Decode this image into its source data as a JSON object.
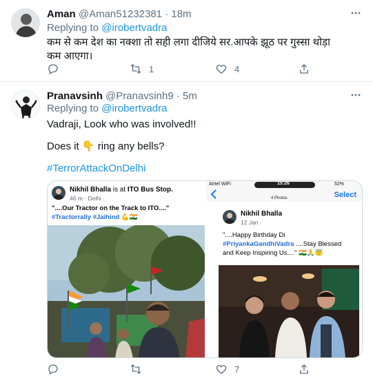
{
  "tweet1": {
    "name": "Aman",
    "handle": "@Aman51232381",
    "separator": "·",
    "time": "18m",
    "replying_prefix": "Replying to",
    "replying_handle": "@irobertvadra",
    "text": "कम से कम देश का नक्शा तो सही लगा दीजिये सर.आपके झूठ पर गुस्सा थोड़ा कम आएगा।",
    "retweet_count": "1",
    "like_count": "4"
  },
  "tweet2": {
    "name": "Pranavsinh",
    "handle": "@Pranavsinh9",
    "separator": "·",
    "time": "5m",
    "replying_prefix": "Replying to",
    "replying_handle": "@irobertvadra",
    "line1": "Vadraji, Look who was involved!!",
    "line2_pre": "Does it",
    "line2_emoji": "👇",
    "line2_post": "ring any bells?",
    "hashtag": "#TerrorAttackOnDelhi",
    "retweet_count": "",
    "like_count": "7"
  },
  "photo_left": {
    "name": "Nikhil Bhalla",
    "status_pre": "is at",
    "place": "ITO Bus Stop.",
    "sub": "46 m · Delhi ·",
    "text": "\"....Our Tractor on the Track to ITO....\"",
    "tag1": "#Tractorrally",
    "tag2": "#Jaihind",
    "emoji": "💪🇮🇳"
  },
  "photo_right": {
    "carrier": "Airtel WiFi",
    "clock": "15:26",
    "battery": "52%",
    "photos_label": "4 Photos",
    "select_label": "Select",
    "name": "Nikhil Bhalla",
    "sub": "12 Jan ·",
    "text_pre": "\"....Happy Birthday Di",
    "tag": "#PriyankaGandhiVadra",
    "text_post": "....Stay Blessed and Keep Inspiring Us....\"",
    "emoji": "🇮🇳🙏😇"
  },
  "colors": {
    "link": "#1b95e0",
    "muted": "#5b7083",
    "text": "#0f1419",
    "border": "#e6ecf0"
  },
  "icons": [
    "more-icon",
    "reply-icon",
    "retweet-icon",
    "like-icon",
    "share-icon",
    "back-chevron-icon"
  ]
}
